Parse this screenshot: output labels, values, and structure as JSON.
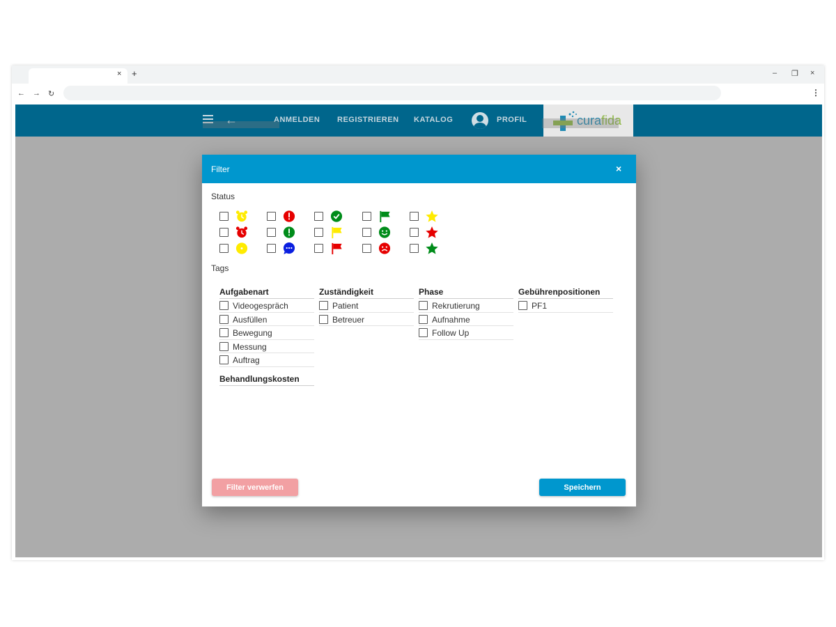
{
  "browser": {
    "tab_close": "×",
    "new_tab": "+",
    "minimize": "–",
    "restore": "❐",
    "close": "×",
    "back": "←",
    "forward": "→",
    "reload": "↻",
    "menu": "⋮",
    "address": ""
  },
  "appbar": {
    "nav": [
      "ANMELDEN",
      "REGISTRIEREN",
      "KATALOG",
      "PROFIL"
    ],
    "logo_part1": "cura",
    "logo_part2": "fida",
    "color": "#00668c"
  },
  "dialog": {
    "title": "Filter",
    "close": "×",
    "status_label": "Status",
    "tags_label": "Tags",
    "header_color": "#0097ce",
    "status_icons": [
      [
        "alarm-clock-yellow",
        "exclamation-red",
        "check-circle-green",
        "flag-green",
        "star-yellow"
      ],
      [
        "alarm-clock-red",
        "exclamation-green",
        "flag-yellow",
        "smiley-happy-green",
        "star-red"
      ],
      [
        "dot-yellow",
        "chat-bubble-blue",
        "flag-red",
        "smiley-sad-red",
        "star-green"
      ]
    ],
    "tags": {
      "aufgabenart": {
        "title": "Aufgabenart",
        "items": [
          "Videogespräch",
          "Ausfüllen",
          "Bewegung",
          "Messung",
          "Auftrag"
        ]
      },
      "zustaendigkeit": {
        "title": "Zuständigkeit",
        "items": [
          "Patient",
          "Betreuer"
        ]
      },
      "phase": {
        "title": "Phase",
        "items": [
          "Rekrutierung",
          "Aufnahme",
          "Follow Up"
        ]
      },
      "gebuehren": {
        "title": "Gebührenpositionen",
        "items": [
          "PF1"
        ]
      },
      "behandlung": {
        "title": "Behandlungskosten"
      }
    },
    "discard_label": "Filter verwerfen",
    "save_label": "Speichern"
  }
}
